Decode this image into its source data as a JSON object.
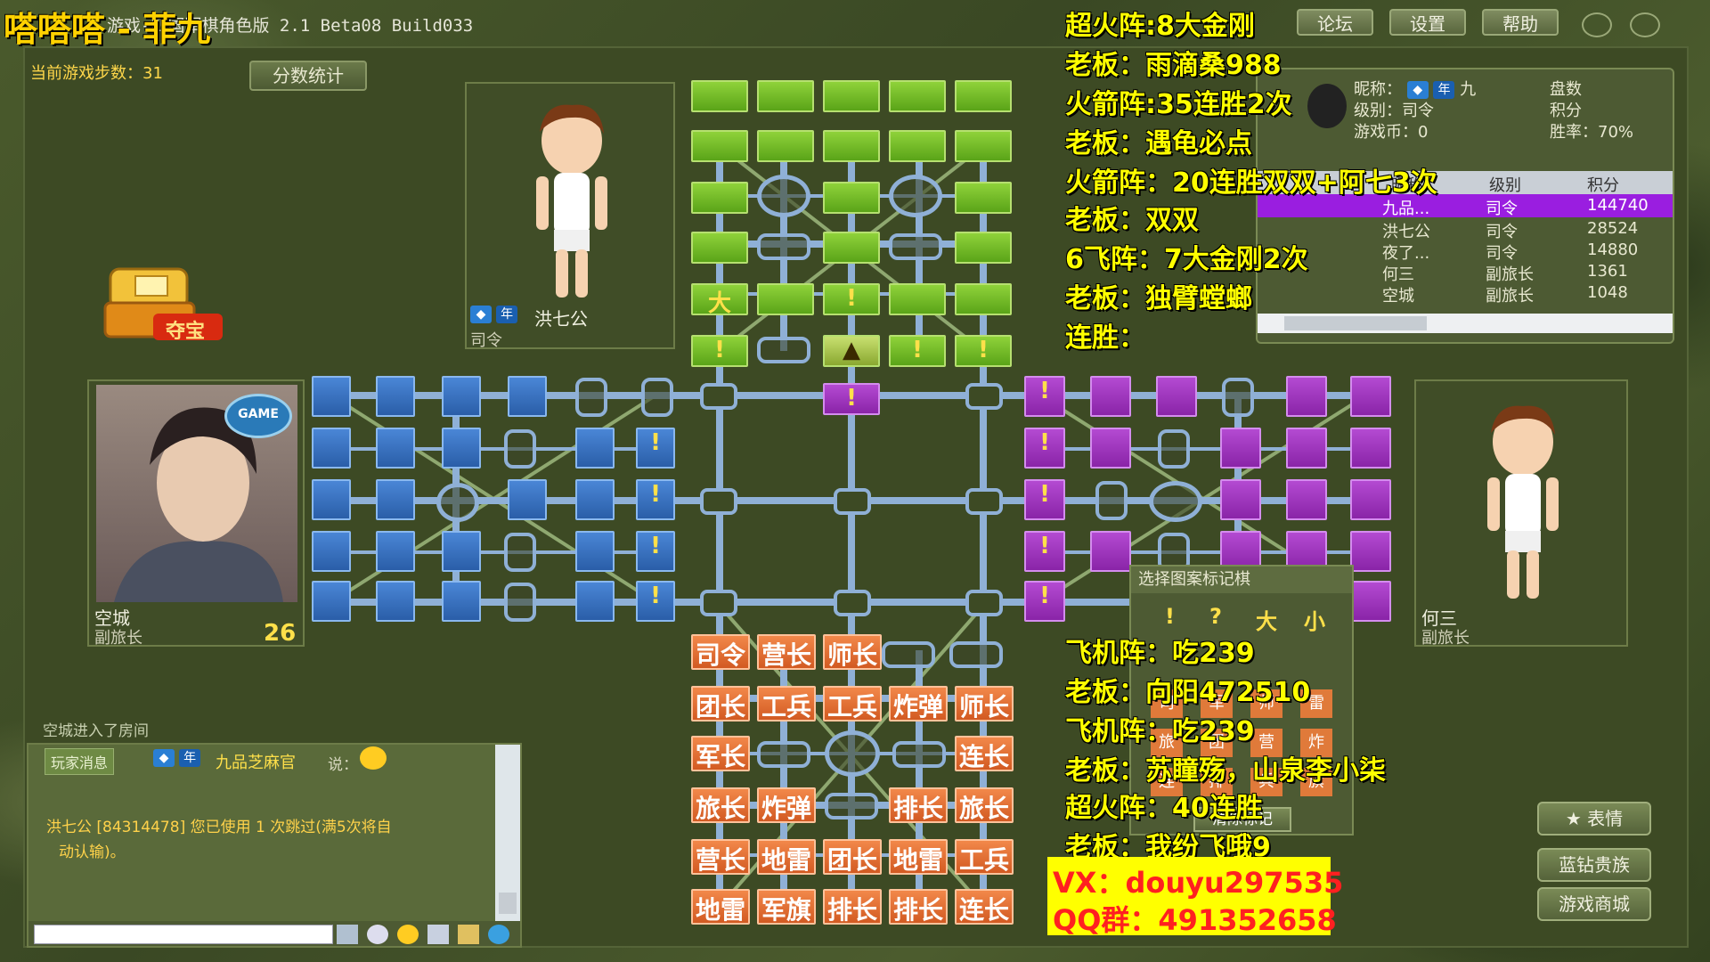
{
  "window": {
    "logo_text": "嗒嗒嗒 - 菲九",
    "title_suffix": "游戏-四国军棋角色版 2.1 Beta08 Build033",
    "top_buttons": [
      "论坛",
      "设置",
      "帮助"
    ]
  },
  "game": {
    "steps_label": "当前游戏步数：31",
    "score_button": "分数统计",
    "treasure_label": "夺宝"
  },
  "players": {
    "top": {
      "name": "洪七公",
      "rank": "司令",
      "badge_year": "年"
    },
    "left": {
      "name": "空城",
      "rank": "副旅长",
      "timer": "26",
      "avatar_badge": "GAME"
    },
    "right": {
      "name": "何三",
      "rank": "副旅长"
    }
  },
  "board": {
    "top_marks": {
      "big": "大",
      "exclaim": "!",
      "arrow": "▲"
    },
    "center_mark": "!",
    "left_marks": [
      "!",
      "!",
      "!",
      "!"
    ],
    "right_marks": [
      "!",
      "!",
      "!",
      "!",
      "!"
    ],
    "bottom_rows": [
      [
        "司令",
        "营长",
        "师长",
        "",
        ""
      ],
      [
        "团长",
        "工兵",
        "工兵",
        "炸弹",
        "师长"
      ],
      [
        "军长",
        "",
        "",
        "",
        "连长"
      ],
      [
        "旅长",
        "炸弹",
        "",
        "排长",
        "旅长"
      ],
      [
        "营长",
        "地雷",
        "团长",
        "地雷",
        "工兵"
      ],
      [
        "地雷",
        "军旗",
        "排长",
        "排长",
        "连长"
      ]
    ]
  },
  "overlay_notes": [
    "超火阵:8大金刚",
    "老板：雨滴桑988",
    "火箭阵:35连胜2次",
    "老板：遇龟必点",
    "火箭阵：20连胜双双+阿七3次",
    "老板：双双",
    "6飞阵：7大金刚2次",
    "老板：独臂螳螂",
    "连胜："
  ],
  "overlay_notes_bottom": [
    "飞机阵：吃239",
    "老板：向阳472510",
    "飞机阵：吃239",
    "老板：苏瞳殇，山泉李小柒",
    "超火阵：40连胜",
    "老板：我纷飞哦9"
  ],
  "contact": {
    "vx": "VX：douyu297535",
    "qq": "QQ群：491352658"
  },
  "profile": {
    "nickname_label": "昵称：",
    "nickname_value": "九",
    "level_label": "级别：司令",
    "coins_label": "游戏币：0",
    "games_label": "盘数",
    "points_label": "积分",
    "winrate_label": "胜率：70%"
  },
  "rank_table": {
    "headers": [
      "昵称",
      "级别",
      "积分"
    ],
    "rows": [
      {
        "name": "九品...",
        "level": "司令",
        "score": "144740"
      },
      {
        "name": "洪七公",
        "level": "司令",
        "score": "28524"
      },
      {
        "name": "夜了...",
        "level": "司令",
        "score": "14880"
      },
      {
        "name": "何三",
        "level": "副旅长",
        "score": "1361"
      },
      {
        "name": "空城",
        "level": "副旅长",
        "score": "1048"
      }
    ]
  },
  "mark_panel": {
    "title": "选择图案标记棋",
    "symbols": [
      "!",
      "?",
      "大",
      "小"
    ],
    "pieces": [
      "司",
      "军",
      "师",
      "旅",
      "团",
      "营",
      "连",
      "排",
      "兵",
      "雷",
      "炸",
      "旗"
    ],
    "clear_button": "清除标记"
  },
  "chat": {
    "system_line": "空城进入了房间",
    "msg_tag": "玩家消息",
    "speaker": "九品芝麻官",
    "says": "说：",
    "notice_line1": "洪七公 [84314478] 您已使用 1 次跳过(满5次将自",
    "notice_line2": "动认输)。",
    "input_placeholder": ""
  },
  "side_buttons": [
    "表情",
    "蓝钻贵族",
    "游戏商城"
  ]
}
